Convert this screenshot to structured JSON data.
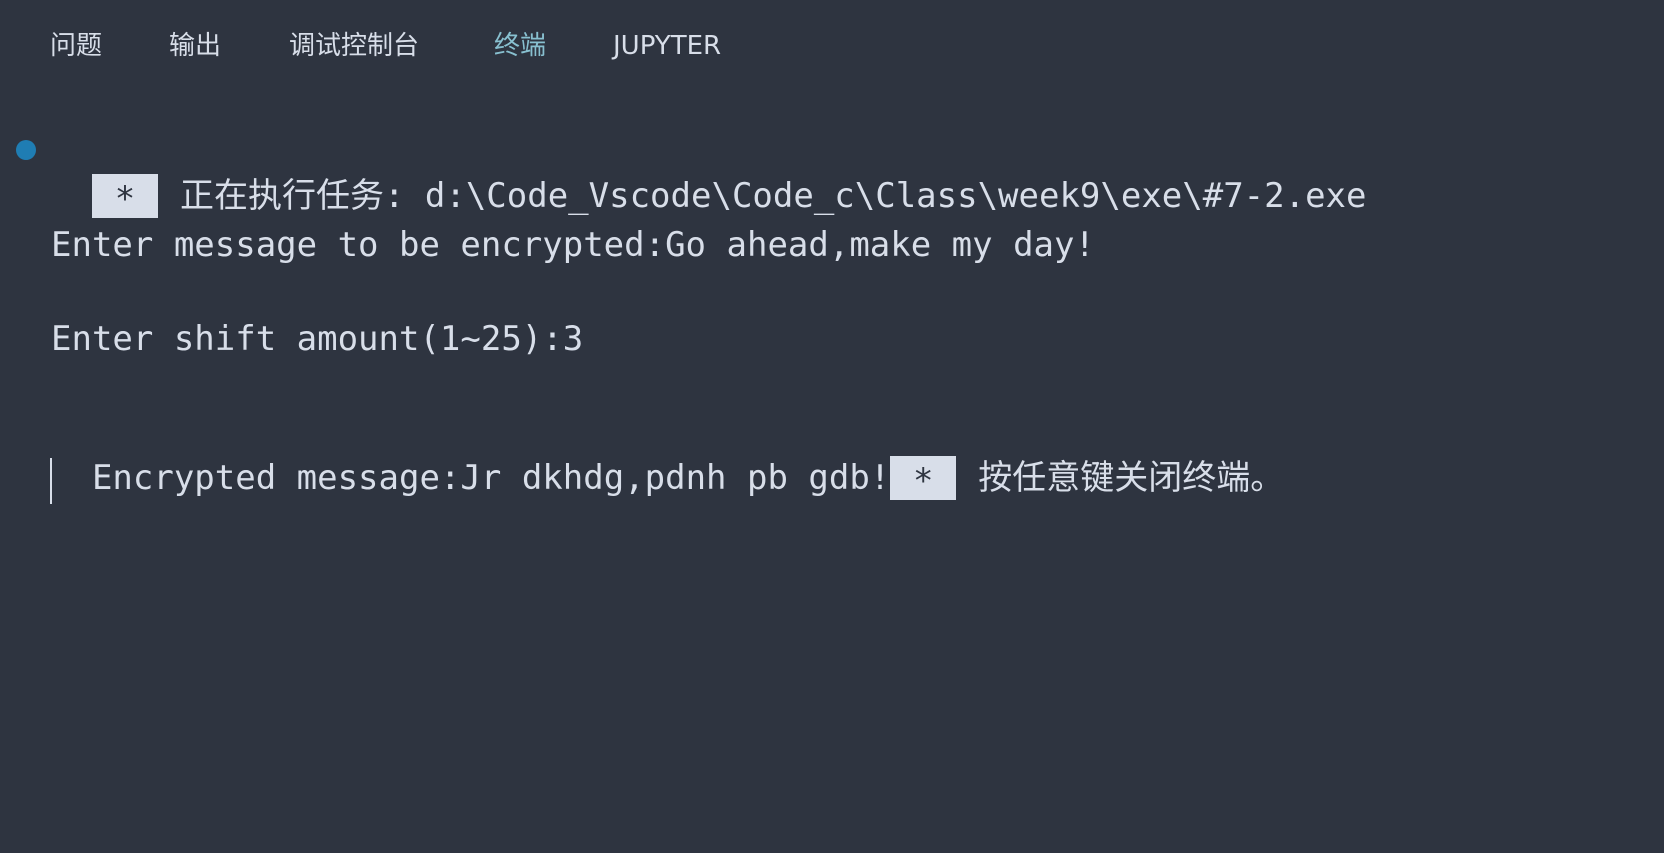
{
  "tabs": [
    {
      "label": "问题",
      "active": false
    },
    {
      "label": "输出",
      "active": false
    },
    {
      "label": "调试控制台",
      "active": false
    },
    {
      "label": "终端",
      "active": true
    },
    {
      "label": "JUPYTER",
      "active": false
    }
  ],
  "terminal": {
    "task_marker": "*",
    "task_label": "正在执行任务: d:\\Code_Vscode\\Code_c\\Class\\week9\\exe\\#7-2.exe",
    "output_lines": [
      "Enter message to be encrypted:Go ahead,make my day!",
      "Enter shift amount(1~25):3",
      "Encrypted message:Jr dkhdg,pdnh pb gdb!"
    ],
    "close_marker": "*",
    "close_prompt": "按任意键关闭终端。"
  },
  "colors": {
    "background": "#2e3440",
    "text": "#d8dee9",
    "active_tab": "#88c0d0",
    "task_dot": "#1f7db3"
  }
}
